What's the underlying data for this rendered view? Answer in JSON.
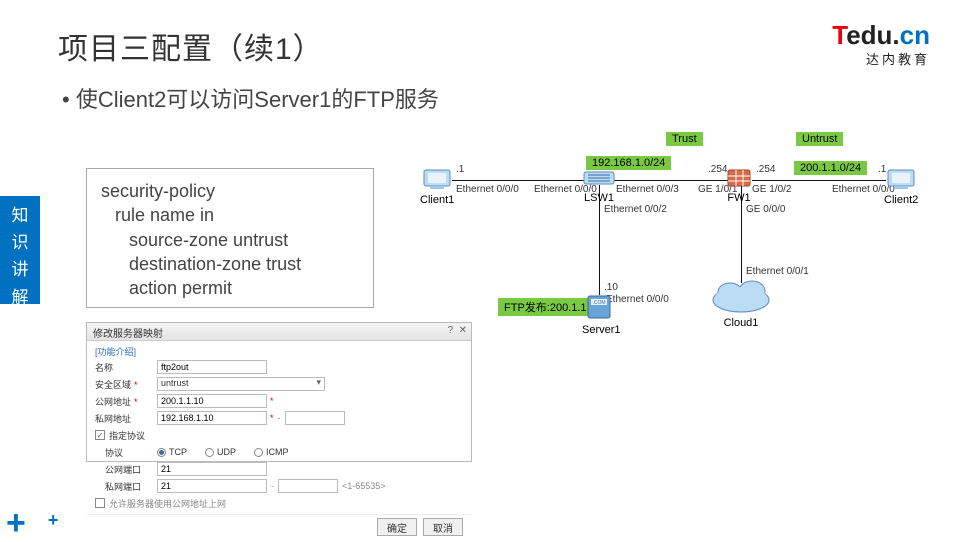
{
  "page": {
    "title": "项目三配置（续1）",
    "bullet": "使Client2可以访问Server1的FTP服务"
  },
  "brand": {
    "t": "T",
    "edu": "edu.",
    "cn": "cn",
    "sub": "达内教育"
  },
  "sidebar": {
    "c1": "知",
    "c2": "识",
    "c3": "讲",
    "c4": "解"
  },
  "code": {
    "l1": "security-policy",
    "l2": "rule name in",
    "l3": "source-zone untrust",
    "l4": "destination-zone trust",
    "l5": "action permit"
  },
  "dialog": {
    "title": "修改服务器映射",
    "help": "?",
    "close": "✕",
    "intro": "[功能介绍]",
    "lbl_name": "名称",
    "val_name": "ftp2out",
    "lbl_zone": "安全区域",
    "val_zone": "untrust",
    "lbl_pub": "公网地址",
    "val_pub": "200.1.1.10",
    "lbl_priv": "私网地址",
    "val_priv": "192.168.1.10",
    "lbl_specproto": "指定协议",
    "lbl_proto": "协议",
    "r_tcp": "TCP",
    "r_udp": "UDP",
    "r_icmp": "ICMP",
    "lbl_pubport": "公网端口",
    "val_pubport": "21",
    "lbl_privport": "私网端口",
    "val_privport": "21",
    "range": "<1-65535>",
    "lbl_allow": "允许服务器使用公网地址上网",
    "btn_ok": "确定",
    "btn_cancel": "取消"
  },
  "net": {
    "trust": "Trust",
    "untrust": "Untrust",
    "subnet1": "192.168.1.0/24",
    "subnet2": "200.1.1.0/24",
    "ip1": ".1",
    "ip254a": ".254",
    "ip254b": ".254",
    "ip1b": ".1",
    "ip10": ".10",
    "eth000a": "Ethernet 0/0/0",
    "eth000b": "Ethernet 0/0/0",
    "eth003": "Ethernet 0/0/3",
    "eth002": "Ethernet 0/0/2",
    "eth000c": "Ethernet 0/0/0",
    "eth000d": "Ethernet 0/0/0",
    "eth001": "Ethernet 0/0/1",
    "ge101": "GE 1/0/1",
    "ge102": "GE 1/0/2",
    "ge000": "GE 0/0/0",
    "ftp_pub": "FTP发布:200.1.1.10",
    "client1": "Client1",
    "lsw1": "LSW1",
    "fw1": "FW1",
    "client2": "Client2",
    "server1": "Server1",
    "cloud1": "Cloud1"
  }
}
